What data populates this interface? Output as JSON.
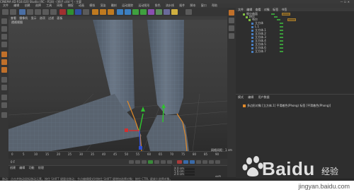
{
  "titlebar": {
    "title": "CINEMA 4D R18.020 Studio (RC - R18) - [椅子.c4d *] - 主要",
    "window_controls": "— ☐ ✕"
  },
  "menubar": {
    "items": [
      "文件",
      "编辑",
      "创建",
      "选择",
      "工具",
      "网格",
      "捕捉",
      "动画",
      "模拟",
      "渲染",
      "雕刻",
      "运动跟踪",
      "运动图形",
      "角色",
      "流水线",
      "插件",
      "脚本",
      "窗口",
      "帮助"
    ]
  },
  "viewport": {
    "menu": [
      "查看",
      "摄像机",
      "显示",
      "选项",
      "过滤",
      "面板"
    ],
    "label": "透视视图",
    "grid_size": "网格间距：1 cm"
  },
  "timeline": {
    "ticks": [
      "0",
      "5",
      "10",
      "15",
      "20",
      "25",
      "30",
      "35",
      "40",
      "45",
      "50",
      "55",
      "60",
      "65",
      "70",
      "75",
      "80",
      "85",
      "90"
    ],
    "end": "0 F"
  },
  "materials": {
    "menu": [
      "创建",
      "编辑",
      "功能",
      "纹理"
    ]
  },
  "coordinates": {
    "rows": [
      "X  0 cm",
      "Y  0 cm",
      "Z  0 cm"
    ],
    "apply": "应用"
  },
  "status": {
    "text": "移动：点击并拖动鼠标移动元素。按住 SHIFT 键量化移动；节点编辑模式时按住 SHIFT 键增加选择对象；按住 CTRL 键减少选择对象。"
  },
  "objects": {
    "menu": [
      "文件",
      "编辑",
      "查看",
      "对象",
      "标签",
      "书签"
    ],
    "rows": [
      "细分曲面",
      "挤压",
      "布尔",
      "立方体",
      "L.1",
      "立方体.1",
      "立方体.2",
      "立方体.3",
      "立方体.4",
      "立方体.5",
      "立方体.6",
      "立方体.7"
    ]
  },
  "attributes": {
    "menu": [
      "模式",
      "编辑",
      "用户数据"
    ],
    "info": "多边形对象 [立方体.1] 平滑着色(Phong) 标签 [平滑着色(Phong)]"
  },
  "watermark": {
    "brand": "Baidu",
    "brand_cn": "经验",
    "url": "jingyan.baidu.com"
  },
  "colors": {
    "accent": "#e08a2a",
    "mesh": "#5f6b78",
    "wire": "#8ea6c2"
  }
}
